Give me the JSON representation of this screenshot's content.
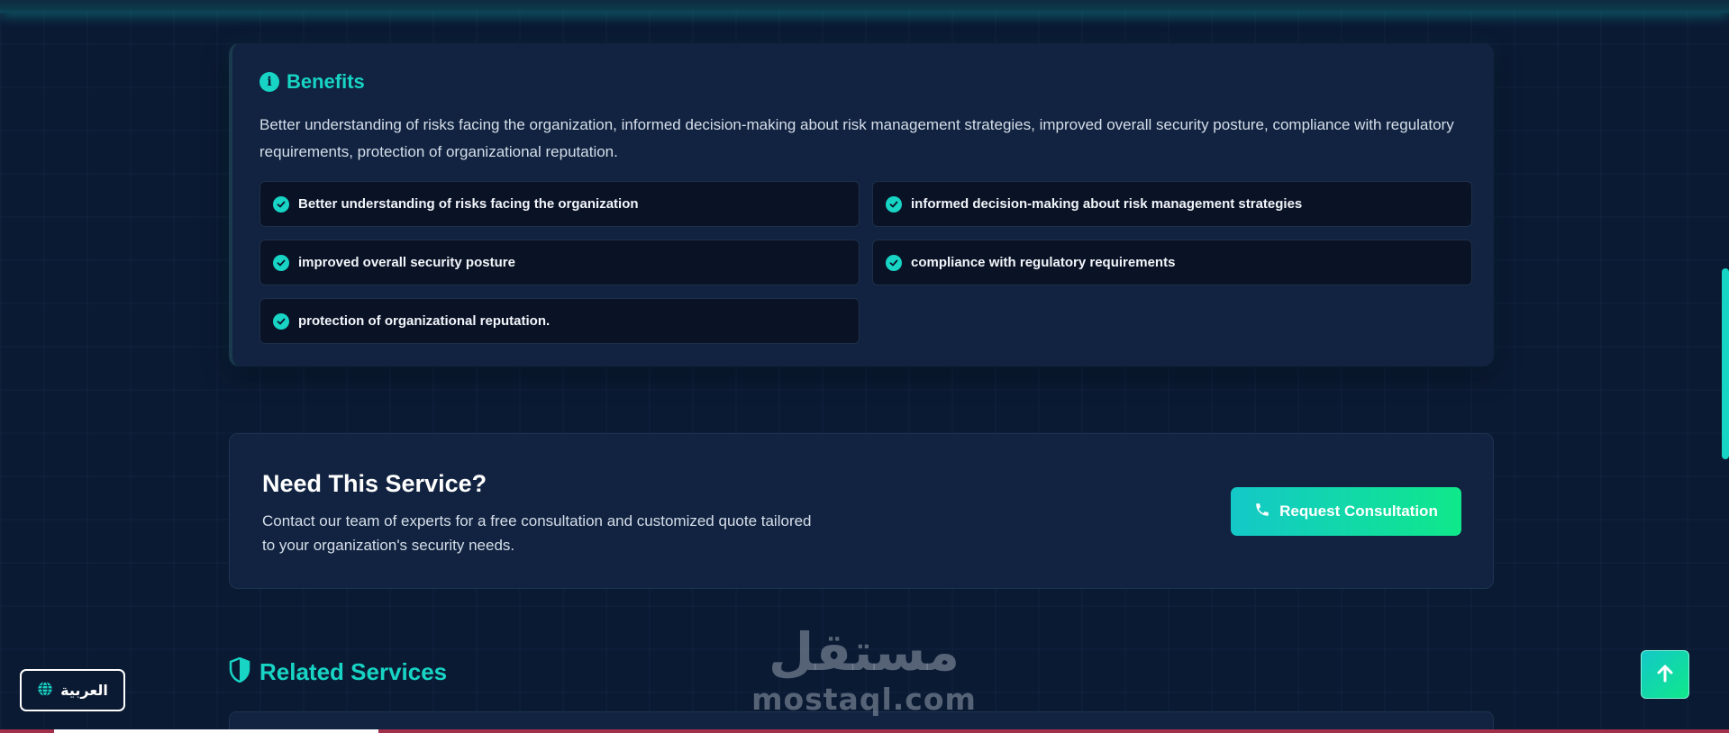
{
  "benefits": {
    "title": "Benefits",
    "description": "Better understanding of risks facing the organization, informed decision-making about risk management strategies, improved overall security posture, compliance with regulatory requirements, protection of organizational reputation.",
    "items": [
      {
        "label": "Better understanding of risks facing the organization"
      },
      {
        "label": "informed decision-making about risk management strategies"
      },
      {
        "label": "improved overall security posture"
      },
      {
        "label": "compliance with regulatory requirements"
      },
      {
        "label": "protection of organizational reputation."
      }
    ]
  },
  "cta": {
    "title": "Need This Service?",
    "description": "Contact our team of experts for a free consultation and customized quote tailored to your organization's security needs.",
    "button_label": "Request Consultation"
  },
  "related": {
    "title": "Related Services"
  },
  "language_button": {
    "label": "العربية"
  },
  "watermark": {
    "arabic": "مستقل",
    "latin": "mostaql.com"
  },
  "colors": {
    "accent": "#17d4c4",
    "accent_green": "#0fe88a",
    "background": "#0b1a33",
    "card": "#112340"
  },
  "icons": {
    "benefits": "info-icon",
    "benefit_item": "check-circle-icon",
    "cta_button": "phone-icon",
    "related": "shield-icon",
    "language": "globe-icon",
    "scroll_top": "arrow-up-icon"
  }
}
